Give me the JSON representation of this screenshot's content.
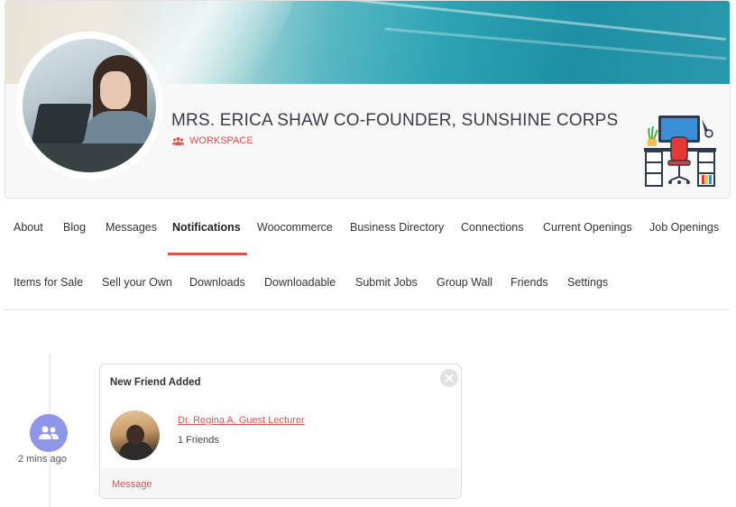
{
  "profile": {
    "name": "MRS. ERICA SHAW CO-FOUNDER, SUNSHINE CORPS",
    "group_icon": "users-icon",
    "workspace_label": "WORKSPACE",
    "accent_color": "#d9534f"
  },
  "nav": {
    "active": "Notifications",
    "items": [
      {
        "label": "About"
      },
      {
        "label": "Blog"
      },
      {
        "label": "Messages"
      },
      {
        "label": "Notifications"
      },
      {
        "label": "Woocommerce"
      },
      {
        "label": "Business Directory"
      },
      {
        "label": "Connections"
      },
      {
        "label": "Current Openings"
      },
      {
        "label": "Job Openings"
      },
      {
        "label": "Items for Sale"
      },
      {
        "label": "Sell your Own"
      },
      {
        "label": "Downloads"
      },
      {
        "label": "Downloadable"
      },
      {
        "label": "Submit Jobs"
      },
      {
        "label": "Group Wall"
      },
      {
        "label": "Friends"
      },
      {
        "label": "Settings"
      }
    ]
  },
  "timeline": {
    "icon": "friends-icon",
    "icon_color": "#8d96e8",
    "time": "2 mins ago"
  },
  "notification": {
    "title": "New Friend Added",
    "friend_name": "Dr. Regina A. Guest Lecturer",
    "friend_count": "1 Friends",
    "footer_link": "Message",
    "close_icon": "close-icon"
  }
}
